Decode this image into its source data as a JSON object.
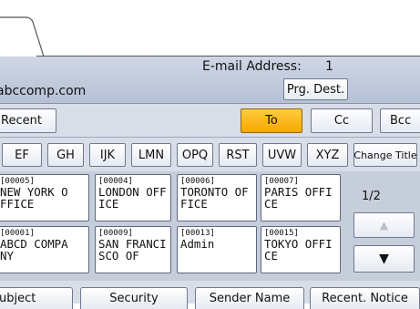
{
  "header": {
    "email_label": "E-mail Address:",
    "email_count": "1"
  },
  "address": {
    "value": "abccomp.com",
    "prg_dest_label": "Prg. Dest."
  },
  "dest_row": {
    "recent": "Recent",
    "to": "To",
    "cc": "Cc",
    "bcc": "Bcc"
  },
  "index_tabs": [
    "EF",
    "GH",
    "IJK",
    "LMN",
    "OPQ",
    "RST",
    "UVW",
    "XYZ"
  ],
  "change_title": "Change Title",
  "entries": [
    {
      "num": "[00005]",
      "line1": "NEW YORK O",
      "line2": "FFICE"
    },
    {
      "num": "[00004]",
      "line1": "LONDON OFF",
      "line2": "ICE"
    },
    {
      "num": "[00006]",
      "line1": "TORONTO OF",
      "line2": "FICE"
    },
    {
      "num": "[00007]",
      "line1": "PARIS OFFI",
      "line2": "CE"
    },
    {
      "num": "[00001]",
      "line1": "ABCD COMPA",
      "line2": "NY"
    },
    {
      "num": "[00009]",
      "line1": "SAN FRANCI",
      "line2": "SCO OF"
    },
    {
      "num": "[00013]",
      "line1": "Admin",
      "line2": ""
    },
    {
      "num": "[00015]",
      "line1": "TOKYO OFFI",
      "line2": "CE"
    }
  ],
  "page_indicator": "1/2",
  "bottom_tabs": [
    "ubject",
    "Security",
    "Sender Name",
    "Recent. Notice"
  ],
  "accent_color": "#f6a800"
}
